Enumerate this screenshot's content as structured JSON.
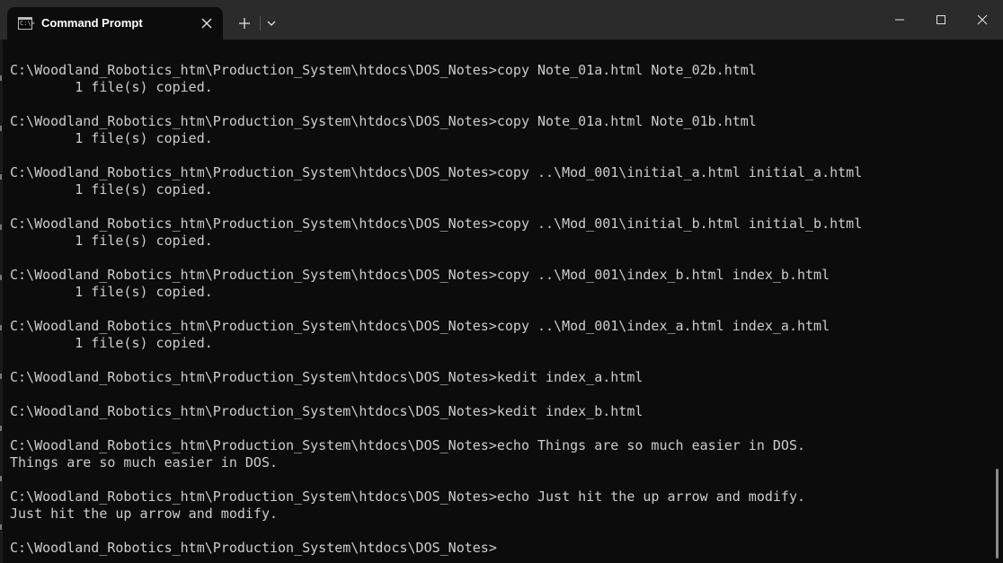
{
  "window": {
    "tab_title": "Command Prompt",
    "tab_icon": "cmd-icon",
    "tab_icon_glyph": "C:\\>",
    "new_tab_icon": "plus-icon",
    "dropdown_icon": "chevron-down-icon",
    "minimize_icon": "minimize-icon",
    "maximize_icon": "maximize-icon",
    "close_icon": "close-icon",
    "colors": {
      "titlebar": "#2b2b2b",
      "background": "#0c0c0c",
      "text": "#cccccc"
    }
  },
  "terminal": {
    "lines": [
      "C:\\Woodland_Robotics_htm\\Production_System\\htdocs\\DOS_Notes>copy Note_01a.html Note_02b.html",
      "        1 file(s) copied.",
      "",
      "C:\\Woodland_Robotics_htm\\Production_System\\htdocs\\DOS_Notes>copy Note_01a.html Note_01b.html",
      "        1 file(s) copied.",
      "",
      "C:\\Woodland_Robotics_htm\\Production_System\\htdocs\\DOS_Notes>copy ..\\Mod_001\\initial_a.html initial_a.html",
      "        1 file(s) copied.",
      "",
      "C:\\Woodland_Robotics_htm\\Production_System\\htdocs\\DOS_Notes>copy ..\\Mod_001\\initial_b.html initial_b.html",
      "        1 file(s) copied.",
      "",
      "C:\\Woodland_Robotics_htm\\Production_System\\htdocs\\DOS_Notes>copy ..\\Mod_001\\index_b.html index_b.html",
      "        1 file(s) copied.",
      "",
      "C:\\Woodland_Robotics_htm\\Production_System\\htdocs\\DOS_Notes>copy ..\\Mod_001\\index_a.html index_a.html",
      "        1 file(s) copied.",
      "",
      "C:\\Woodland_Robotics_htm\\Production_System\\htdocs\\DOS_Notes>kedit index_a.html",
      "",
      "C:\\Woodland_Robotics_htm\\Production_System\\htdocs\\DOS_Notes>kedit index_b.html",
      "",
      "C:\\Woodland_Robotics_htm\\Production_System\\htdocs\\DOS_Notes>echo Things are so much easier in DOS.",
      "Things are so much easier in DOS.",
      "",
      "C:\\Woodland_Robotics_htm\\Production_System\\htdocs\\DOS_Notes>echo Just hit the up arrow and modify.",
      "Just hit the up arrow and modify.",
      "",
      "C:\\Woodland_Robotics_htm\\Production_System\\htdocs\\DOS_Notes>"
    ]
  }
}
